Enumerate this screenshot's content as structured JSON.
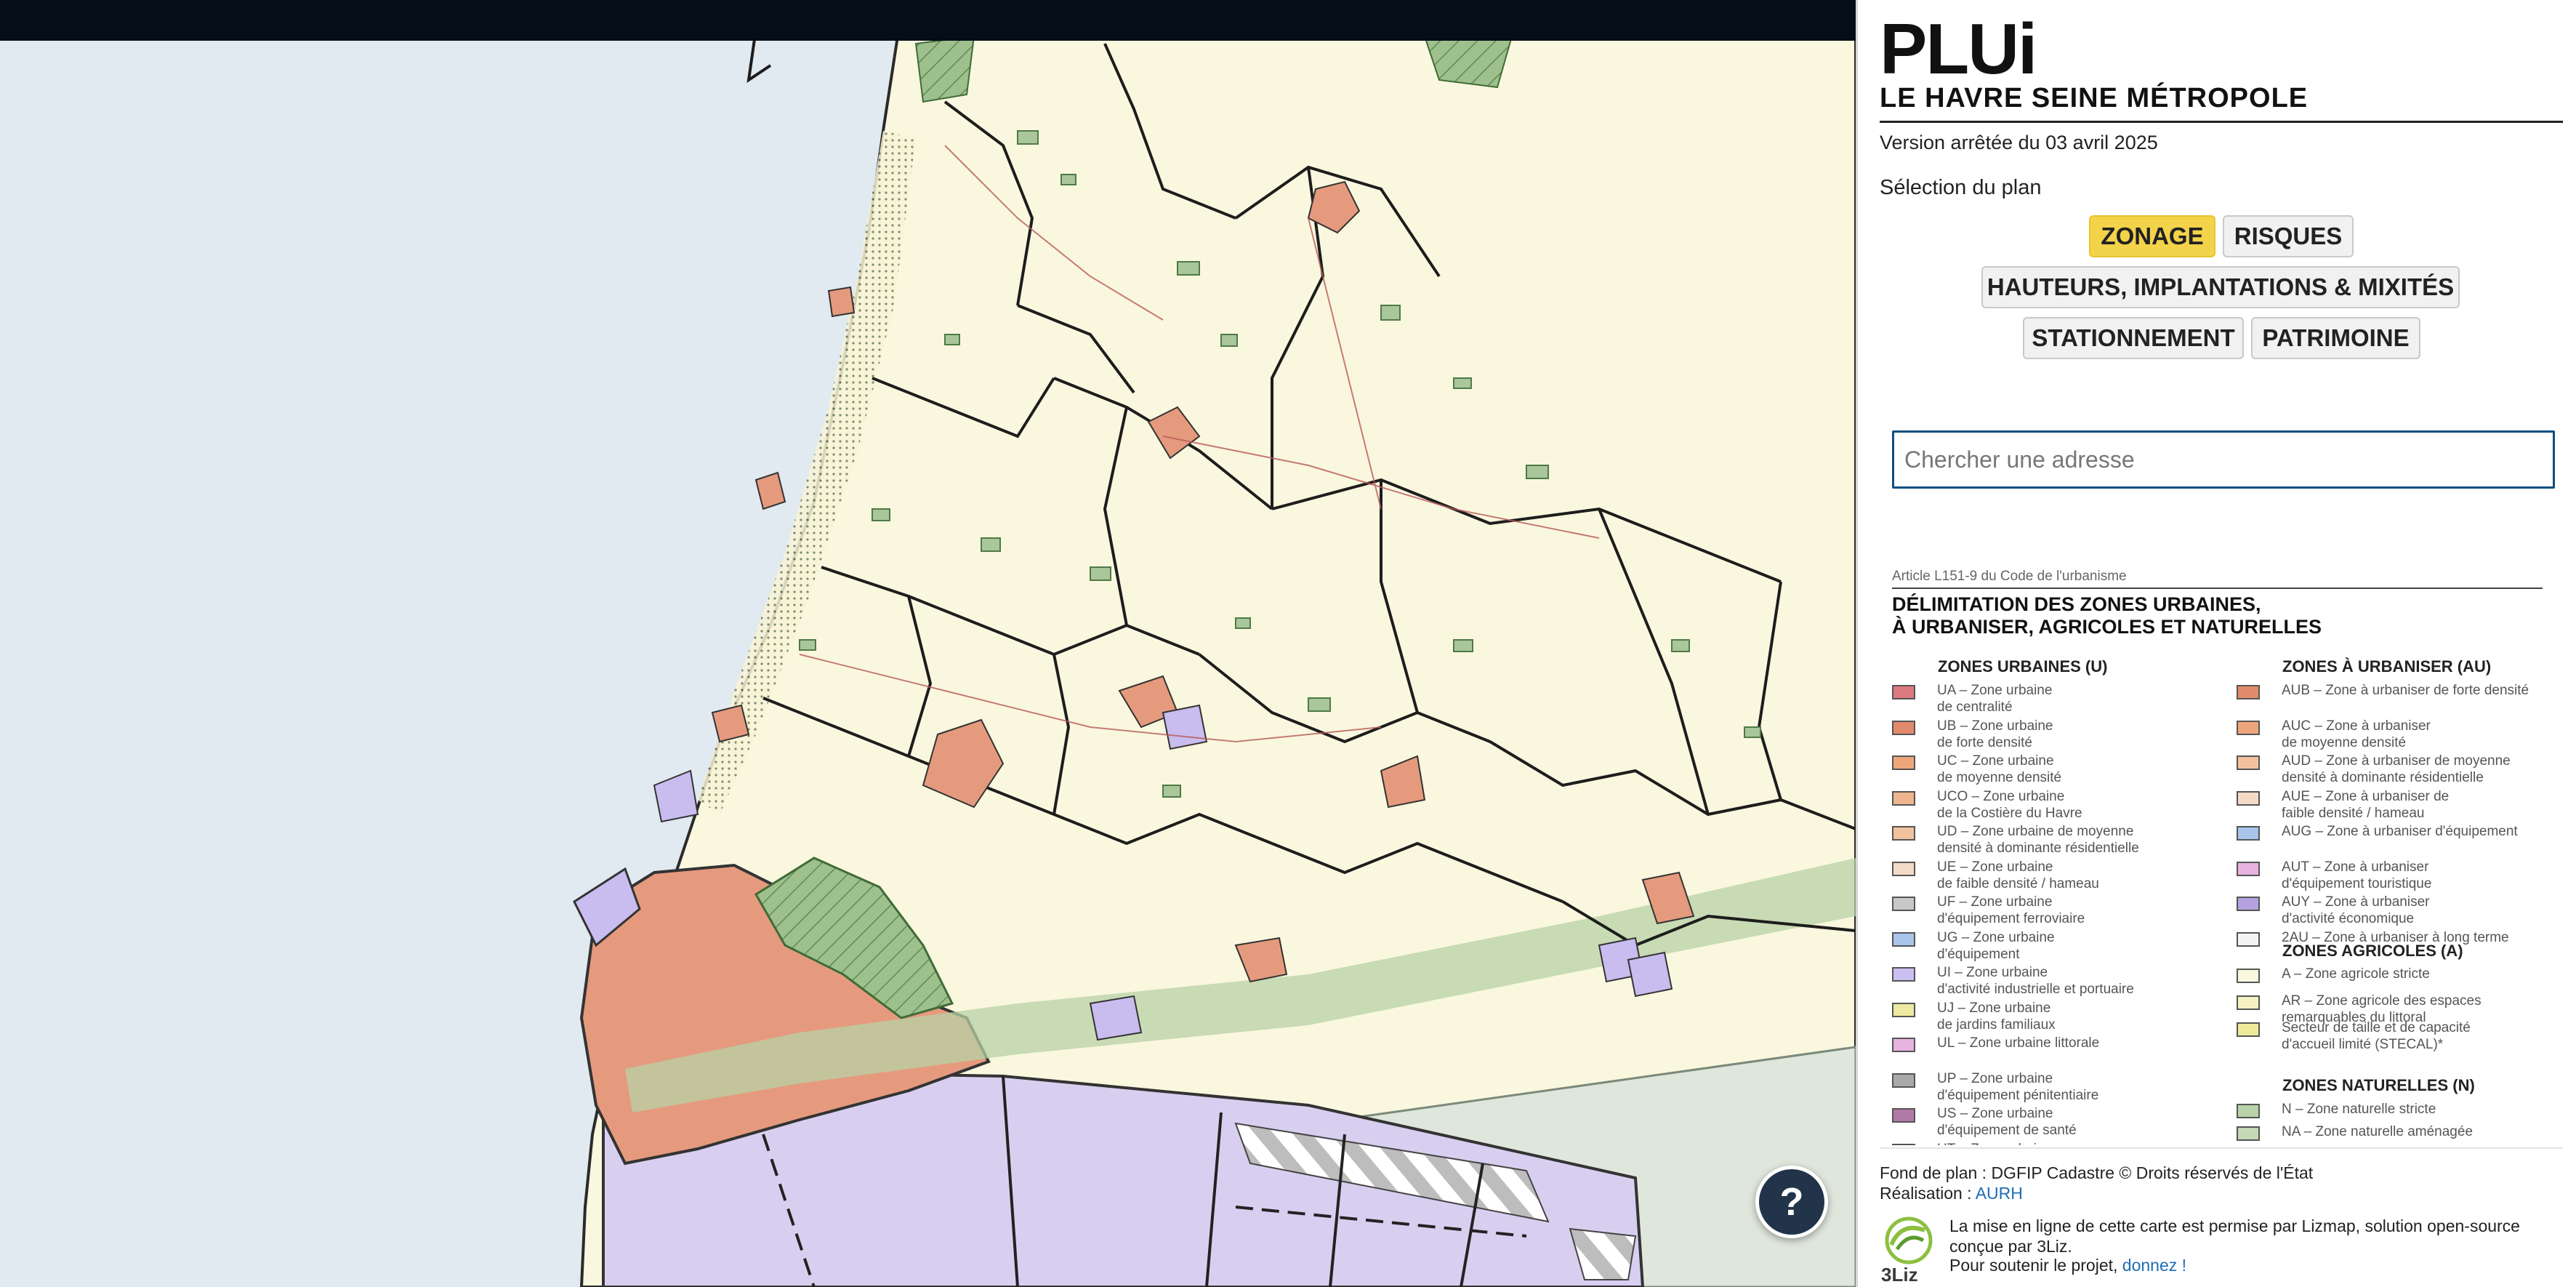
{
  "colors": {
    "accent": "#f3d34a",
    "sea": "#e1e9f1",
    "agricultural": "#faf7df",
    "urban": "#e59a7e",
    "port": "#d8cff0",
    "natural": "#a9c79a",
    "topbar": "#050d18"
  },
  "header": {
    "title": "PLUi",
    "subtitle": "LE HAVRE SEINE MÉTROPOLE",
    "version": "Version arrêtée du 03 avril 2025"
  },
  "plan": {
    "label": "Sélection du plan",
    "buttons": [
      "ZONAGE",
      "RISQUES",
      "HAUTEURS, IMPLANTATIONS & MIXITÉS",
      "STATIONNEMENT",
      "PATRIMOINE"
    ],
    "active": "ZONAGE"
  },
  "search": {
    "placeholder": "Chercher une adresse"
  },
  "legend": {
    "article": "Article L151-9 du Code de l'urbanisme",
    "title_line1": "DÉLIMITATION DES ZONES URBAINES,",
    "title_line2": "À URBANISER, AGRICOLES ET NATURELLES",
    "urban": {
      "heading": "ZONES URBAINES (U)",
      "items": [
        {
          "label": "UA – Zone urbaine\nde centralité",
          "color": "#dc7a82"
        },
        {
          "label": "UB – Zone urbaine\nde forte densité",
          "color": "#e28a6c"
        },
        {
          "label": "UC – Zone urbaine\nde moyenne densité",
          "color": "#eda67c"
        },
        {
          "label": "UCO – Zone urbaine\nde la Costière du Havre",
          "color": "#efb58e"
        },
        {
          "label": "UD – Zone urbaine de moyenne\ndensité à dominante résidentielle",
          "color": "#f2c29f"
        },
        {
          "label": "UE – Zone urbaine\nde faible densité / hameau",
          "color": "#f4dbc8"
        },
        {
          "label": "UF – Zone urbaine\nd'équipement ferroviaire",
          "color": "#c8c8c8"
        },
        {
          "label": "UG – Zone urbaine\nd'équipement",
          "color": "#a9c5ea"
        },
        {
          "label": "UI – Zone urbaine\nd'activité industrielle et portuaire",
          "color": "#cbbef0"
        },
        {
          "label": "UJ – Zone urbaine\nde jardins familiaux",
          "color": "#eeeaa0"
        },
        {
          "label": "UL – Zone urbaine littorale",
          "color": "#e7b3e1"
        },
        {
          "label": "UP – Zone urbaine\nd'équipement pénitentiaire",
          "color": "#a9a9a9"
        },
        {
          "label": "US – Zone urbaine\nd'équipement de santé",
          "color": "#b07aa6"
        },
        {
          "label": "UT – Zone urbaine",
          "color": "#f0b4d4"
        }
      ]
    },
    "au": {
      "heading": "ZONES À URBANISER (AU)",
      "items": [
        {
          "label": "AUB – Zone à urbaniser de forte densité",
          "color": "#e28a6c"
        },
        {
          "label": "AUC – Zone à urbaniser\nde moyenne densité",
          "color": "#eda67c"
        },
        {
          "label": "AUD – Zone à urbaniser de moyenne\ndensité à dominante résidentielle",
          "color": "#f2c29f"
        },
        {
          "label": "AUE – Zone à urbaniser de\nfaible densité / hameau",
          "color": "#f4dbc8"
        },
        {
          "label": "AUG – Zone à urbaniser d'équipement",
          "color": "#a9c5ea"
        },
        {
          "label": "AUT – Zone à urbaniser\nd'équipement touristique",
          "color": "#e7b3e1"
        },
        {
          "label": "AUY – Zone à urbaniser\nd'activité économique",
          "color": "#b4a2df"
        },
        {
          "label": "2AU – Zone à urbaniser à long terme",
          "color": "#f4f4f4"
        }
      ]
    },
    "agri": {
      "heading": "ZONES AGRICOLES (A)",
      "items": [
        {
          "label": "A – Zone agricole stricte",
          "color": "#faf7df"
        },
        {
          "label": "AR – Zone agricole des espaces\nremarquables du littoral",
          "color": "#f6f1c2"
        },
        {
          "label": "Secteur de taille et de capacité\nd'accueil limité (STECAL)*",
          "color": "#eeea9a"
        }
      ]
    },
    "natural": {
      "heading": "ZONES NATURELLES (N)",
      "items": [
        {
          "label": "N – Zone naturelle stricte",
          "color": "#b9d3a8"
        },
        {
          "label": "NA – Zone naturelle aménagée",
          "color": "#c6d8b6"
        }
      ]
    }
  },
  "footer": {
    "basemap": "Fond de plan : DGFIP Cadastre © Droits réservés de l'État",
    "realisation_prefix": "Réalisation : ",
    "realisation_link": "AURH",
    "lizmap_text": "La mise en ligne de cette carte est permise par Lizmap, solution open-source conçue par 3Liz.",
    "support_prefix": "Pour soutenir le projet, ",
    "support_link": "donnez !",
    "logo_text": "3Liz"
  },
  "map": {
    "help_label": "?"
  }
}
